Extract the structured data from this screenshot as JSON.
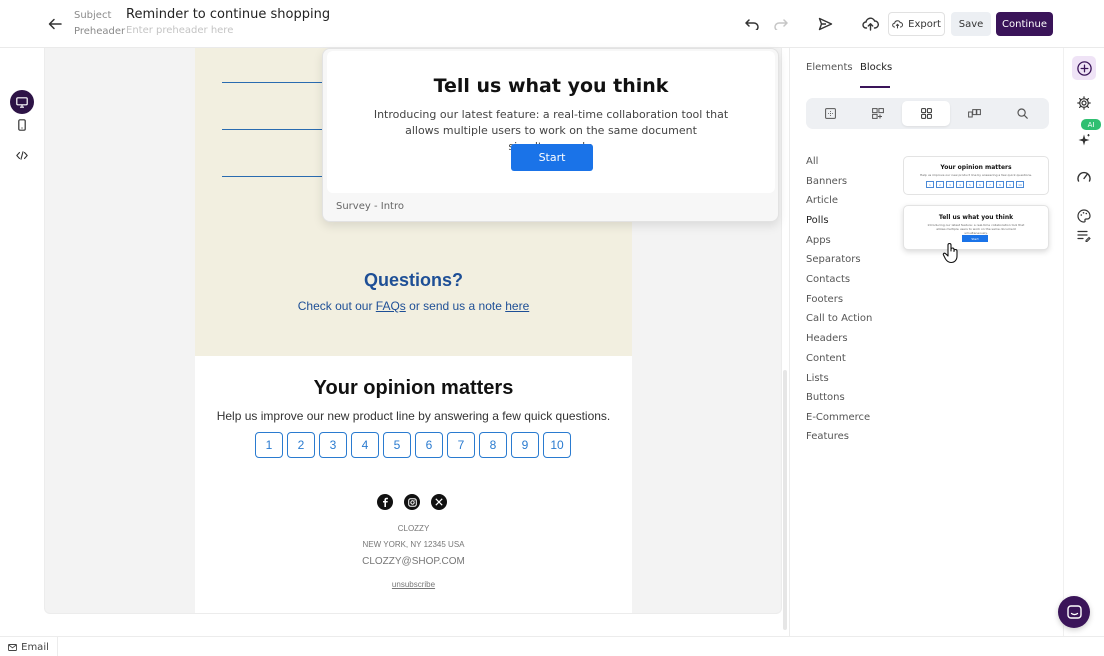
{
  "header": {
    "subject_label": "Subject",
    "subject_value": "Reminder to continue shopping",
    "preheader_label": "Preheader",
    "preheader_placeholder": "Enter preheader here",
    "export_label": "Export",
    "save_label": "Save",
    "continue_label": "Continue"
  },
  "email": {
    "questions_title": "Questions?",
    "questions_prefix": "Check out our ",
    "faqs_link": "FAQs",
    "questions_middle": " or send us a note ",
    "here_link": "here",
    "opinion_title": "Your opinion matters",
    "opinion_text": "Help us improve our new product line by answering a few quick questions.",
    "scale": [
      "1",
      "2",
      "3",
      "4",
      "5",
      "6",
      "7",
      "8",
      "9",
      "10"
    ],
    "company": "CLOZZY",
    "address": "NEW YORK, NY 12345 USA",
    "email_address": "CLOZZY@SHOP.COM",
    "unsubscribe": "unsubscribe"
  },
  "popover": {
    "title": "Tell us what you think",
    "description": "Introducing our latest feature: a real-time collaboration tool that allows multiple users to work on the same document simultaneously.",
    "button": "Start",
    "footer": "Survey - Intro"
  },
  "panel": {
    "tabs": [
      "Elements",
      "Blocks"
    ],
    "active_tab": "Blocks",
    "categories": [
      "All",
      "Banners",
      "Article",
      "Polls",
      "Apps",
      "Separators",
      "Contacts",
      "Footers",
      "Call to Action",
      "Headers",
      "Content",
      "Lists",
      "Buttons",
      "E-Commerce",
      "Features"
    ],
    "active_category": "Polls",
    "thumbnails": [
      {
        "title": "Your opinion matters",
        "text": "Help us improve our new product line by answering a few quick questions.",
        "scale": [
          "1",
          "2",
          "3",
          "4",
          "5",
          "6",
          "7",
          "8",
          "9",
          "10"
        ]
      },
      {
        "title": "Tell us what you think",
        "text": "Introducing our latest feature: a real-time collaboration tool that allows multiple users to work on the same document simultaneously.",
        "button": "Start"
      }
    ]
  },
  "right_rail": {
    "ai_badge": "AI"
  },
  "footer": {
    "email_tab": "Email"
  },
  "colors": {
    "accent": "#3a1459",
    "link_blue": "#1e4f96",
    "button_blue": "#1a73e8",
    "beige": "#f2efe0",
    "ai_green": "#2fbf71"
  }
}
